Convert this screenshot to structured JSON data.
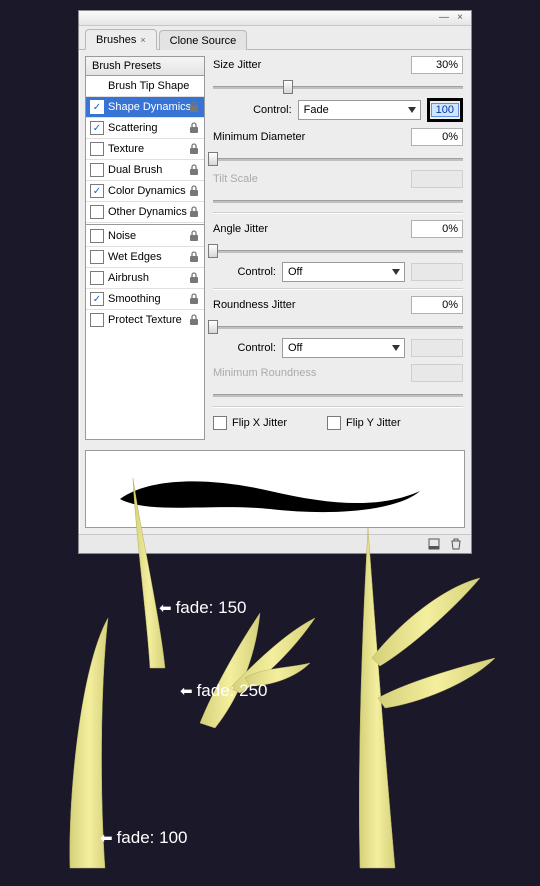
{
  "tabs": {
    "brushes": "Brushes",
    "clone_source": "Clone Source"
  },
  "titlebar": {
    "minimize": "—",
    "close": "×"
  },
  "sidebar": {
    "header": "Brush Presets",
    "items": [
      {
        "label": "Brush Tip Shape",
        "check": null,
        "lock": false
      },
      {
        "label": "Shape Dynamics",
        "check": true,
        "lock": true,
        "selected": true
      },
      {
        "label": "Scattering",
        "check": true,
        "lock": true
      },
      {
        "label": "Texture",
        "check": false,
        "lock": true
      },
      {
        "label": "Dual Brush",
        "check": false,
        "lock": true
      },
      {
        "label": "Color Dynamics",
        "check": true,
        "lock": true
      },
      {
        "label": "Other Dynamics",
        "check": false,
        "lock": true
      },
      {
        "label": "Noise",
        "check": false,
        "lock": true,
        "sep_before": true
      },
      {
        "label": "Wet Edges",
        "check": false,
        "lock": true
      },
      {
        "label": "Airbrush",
        "check": false,
        "lock": true
      },
      {
        "label": "Smoothing",
        "check": true,
        "lock": true
      },
      {
        "label": "Protect Texture",
        "check": false,
        "lock": true
      }
    ]
  },
  "main": {
    "size_jitter_label": "Size Jitter",
    "size_jitter_value": "30%",
    "size_jitter_slider_pct": 30,
    "control_label": "Control:",
    "size_control_value": "Fade",
    "fade_value": "100",
    "min_diameter_label": "Minimum Diameter",
    "min_diameter_value": "0%",
    "tilt_scale_label": "Tilt Scale",
    "angle_jitter_label": "Angle Jitter",
    "angle_jitter_value": "0%",
    "angle_control_value": "Off",
    "roundness_jitter_label": "Roundness Jitter",
    "roundness_jitter_value": "0%",
    "roundness_control_value": "Off",
    "min_roundness_label": "Minimum Roundness",
    "flip_x_label": "Flip X Jitter",
    "flip_y_label": "Flip Y Jitter"
  },
  "annotations": {
    "arrow_glyph": "⬅",
    "fade150": "fade: 150",
    "fade250": "fade: 250",
    "fade100": "fade: 100"
  }
}
